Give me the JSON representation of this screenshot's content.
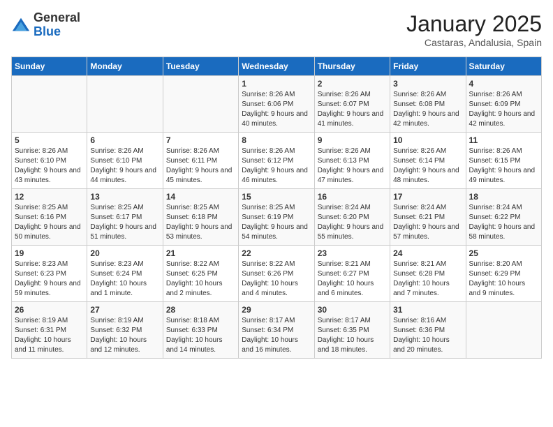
{
  "logo": {
    "general": "General",
    "blue": "Blue"
  },
  "title": "January 2025",
  "location": "Castaras, Andalusia, Spain",
  "headers": [
    "Sunday",
    "Monday",
    "Tuesday",
    "Wednesday",
    "Thursday",
    "Friday",
    "Saturday"
  ],
  "weeks": [
    [
      {
        "day": "",
        "info": ""
      },
      {
        "day": "",
        "info": ""
      },
      {
        "day": "",
        "info": ""
      },
      {
        "day": "1",
        "info": "Sunrise: 8:26 AM\nSunset: 6:06 PM\nDaylight: 9 hours\nand 40 minutes."
      },
      {
        "day": "2",
        "info": "Sunrise: 8:26 AM\nSunset: 6:07 PM\nDaylight: 9 hours\nand 41 minutes."
      },
      {
        "day": "3",
        "info": "Sunrise: 8:26 AM\nSunset: 6:08 PM\nDaylight: 9 hours\nand 42 minutes."
      },
      {
        "day": "4",
        "info": "Sunrise: 8:26 AM\nSunset: 6:09 PM\nDaylight: 9 hours\nand 42 minutes."
      }
    ],
    [
      {
        "day": "5",
        "info": "Sunrise: 8:26 AM\nSunset: 6:10 PM\nDaylight: 9 hours\nand 43 minutes."
      },
      {
        "day": "6",
        "info": "Sunrise: 8:26 AM\nSunset: 6:10 PM\nDaylight: 9 hours\nand 44 minutes."
      },
      {
        "day": "7",
        "info": "Sunrise: 8:26 AM\nSunset: 6:11 PM\nDaylight: 9 hours\nand 45 minutes."
      },
      {
        "day": "8",
        "info": "Sunrise: 8:26 AM\nSunset: 6:12 PM\nDaylight: 9 hours\nand 46 minutes."
      },
      {
        "day": "9",
        "info": "Sunrise: 8:26 AM\nSunset: 6:13 PM\nDaylight: 9 hours\nand 47 minutes."
      },
      {
        "day": "10",
        "info": "Sunrise: 8:26 AM\nSunset: 6:14 PM\nDaylight: 9 hours\nand 48 minutes."
      },
      {
        "day": "11",
        "info": "Sunrise: 8:26 AM\nSunset: 6:15 PM\nDaylight: 9 hours\nand 49 minutes."
      }
    ],
    [
      {
        "day": "12",
        "info": "Sunrise: 8:25 AM\nSunset: 6:16 PM\nDaylight: 9 hours\nand 50 minutes."
      },
      {
        "day": "13",
        "info": "Sunrise: 8:25 AM\nSunset: 6:17 PM\nDaylight: 9 hours\nand 51 minutes."
      },
      {
        "day": "14",
        "info": "Sunrise: 8:25 AM\nSunset: 6:18 PM\nDaylight: 9 hours\nand 53 minutes."
      },
      {
        "day": "15",
        "info": "Sunrise: 8:25 AM\nSunset: 6:19 PM\nDaylight: 9 hours\nand 54 minutes."
      },
      {
        "day": "16",
        "info": "Sunrise: 8:24 AM\nSunset: 6:20 PM\nDaylight: 9 hours\nand 55 minutes."
      },
      {
        "day": "17",
        "info": "Sunrise: 8:24 AM\nSunset: 6:21 PM\nDaylight: 9 hours\nand 57 minutes."
      },
      {
        "day": "18",
        "info": "Sunrise: 8:24 AM\nSunset: 6:22 PM\nDaylight: 9 hours\nand 58 minutes."
      }
    ],
    [
      {
        "day": "19",
        "info": "Sunrise: 8:23 AM\nSunset: 6:23 PM\nDaylight: 9 hours\nand 59 minutes."
      },
      {
        "day": "20",
        "info": "Sunrise: 8:23 AM\nSunset: 6:24 PM\nDaylight: 10 hours\nand 1 minute."
      },
      {
        "day": "21",
        "info": "Sunrise: 8:22 AM\nSunset: 6:25 PM\nDaylight: 10 hours\nand 2 minutes."
      },
      {
        "day": "22",
        "info": "Sunrise: 8:22 AM\nSunset: 6:26 PM\nDaylight: 10 hours\nand 4 minutes."
      },
      {
        "day": "23",
        "info": "Sunrise: 8:21 AM\nSunset: 6:27 PM\nDaylight: 10 hours\nand 6 minutes."
      },
      {
        "day": "24",
        "info": "Sunrise: 8:21 AM\nSunset: 6:28 PM\nDaylight: 10 hours\nand 7 minutes."
      },
      {
        "day": "25",
        "info": "Sunrise: 8:20 AM\nSunset: 6:29 PM\nDaylight: 10 hours\nand 9 minutes."
      }
    ],
    [
      {
        "day": "26",
        "info": "Sunrise: 8:19 AM\nSunset: 6:31 PM\nDaylight: 10 hours\nand 11 minutes."
      },
      {
        "day": "27",
        "info": "Sunrise: 8:19 AM\nSunset: 6:32 PM\nDaylight: 10 hours\nand 12 minutes."
      },
      {
        "day": "28",
        "info": "Sunrise: 8:18 AM\nSunset: 6:33 PM\nDaylight: 10 hours\nand 14 minutes."
      },
      {
        "day": "29",
        "info": "Sunrise: 8:17 AM\nSunset: 6:34 PM\nDaylight: 10 hours\nand 16 minutes."
      },
      {
        "day": "30",
        "info": "Sunrise: 8:17 AM\nSunset: 6:35 PM\nDaylight: 10 hours\nand 18 minutes."
      },
      {
        "day": "31",
        "info": "Sunrise: 8:16 AM\nSunset: 6:36 PM\nDaylight: 10 hours\nand 20 minutes."
      },
      {
        "day": "",
        "info": ""
      }
    ]
  ]
}
